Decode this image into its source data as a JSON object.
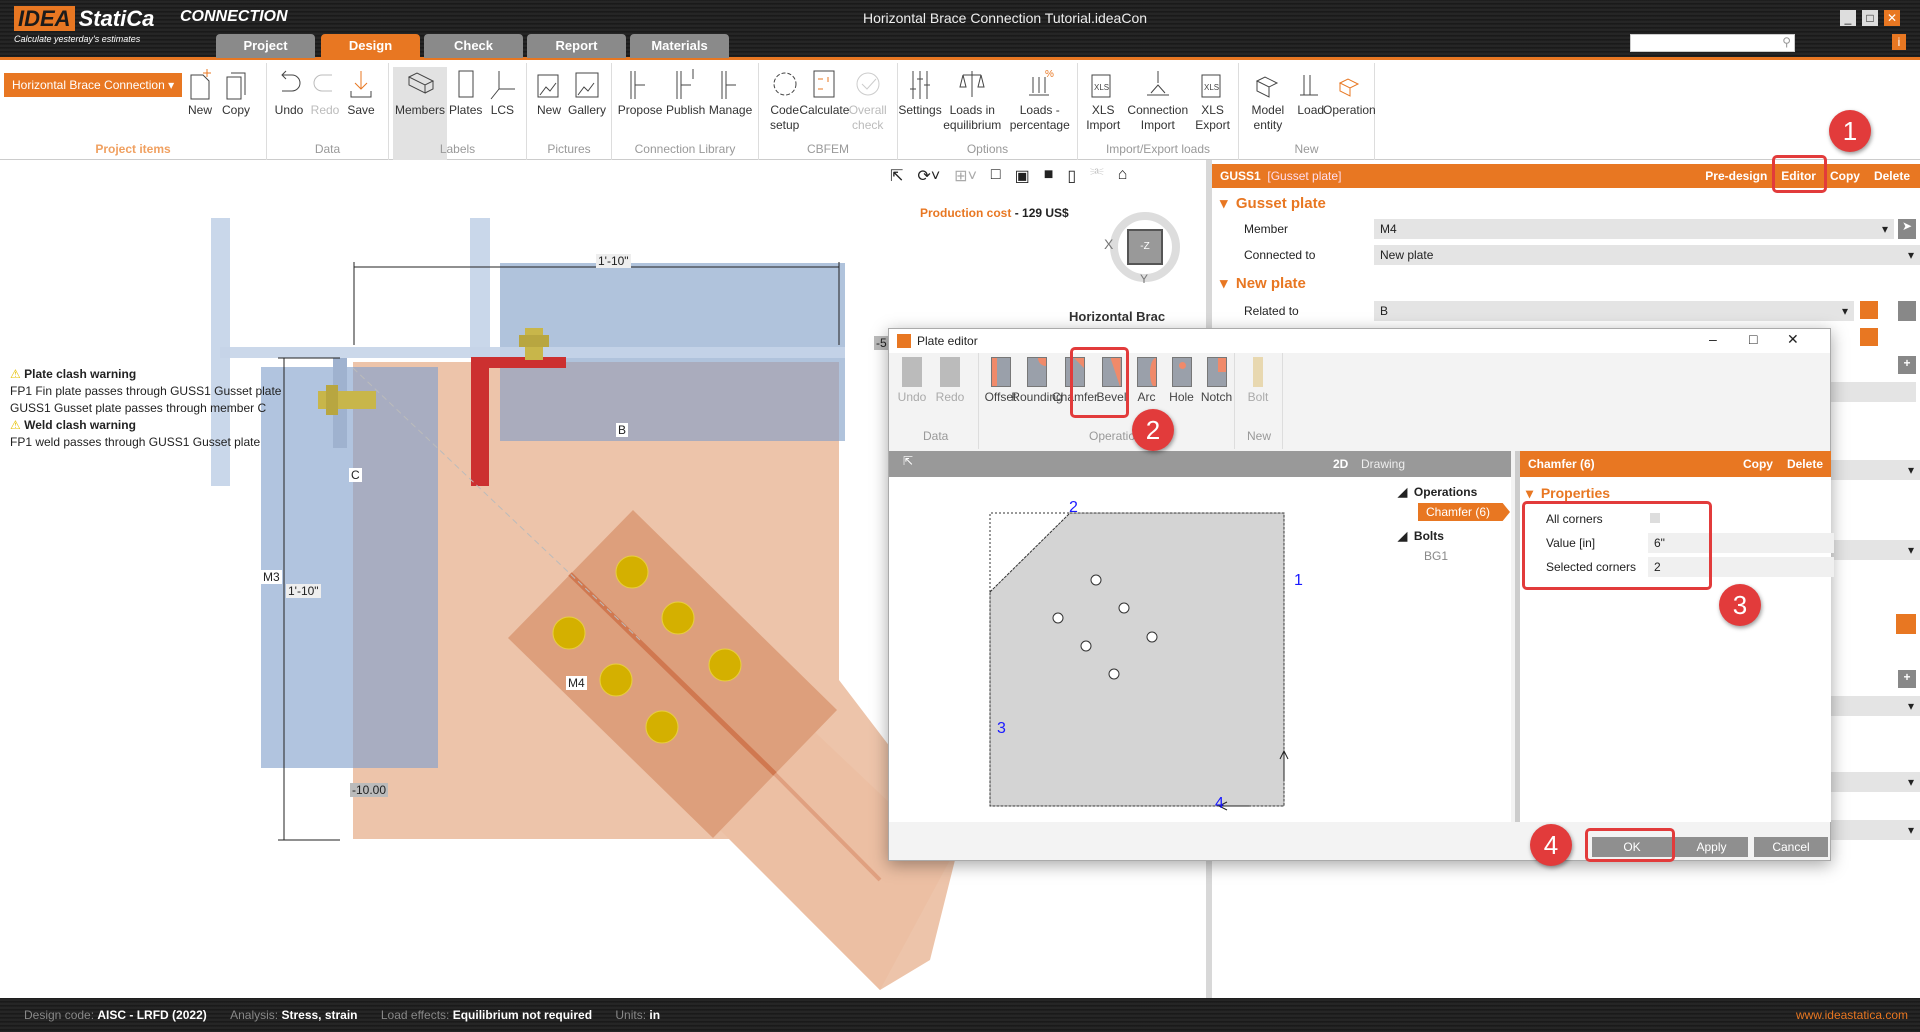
{
  "app": {
    "logo": "IDEA StatiCa",
    "product": "CONNECTION",
    "tagline": "Calculate yesterday's estimates",
    "window_title": "Horizontal Brace Connection Tutorial.ideaCon"
  },
  "tabs": [
    "Project",
    "Design",
    "Check",
    "Report",
    "Materials"
  ],
  "ribbon": {
    "project_items": {
      "dropdown": "Horizontal Brace Connection",
      "buttons": [
        "New",
        "Copy"
      ],
      "label": "Project items"
    },
    "data": {
      "buttons": [
        "Undo",
        "Redo",
        "Save"
      ],
      "label": "Data"
    },
    "labels": {
      "buttons": [
        "Members",
        "Plates",
        "LCS"
      ],
      "label": "Labels"
    },
    "pictures": {
      "buttons": [
        "New",
        "Gallery"
      ],
      "label": "Pictures"
    },
    "library": {
      "buttons": [
        "Propose",
        "Publish",
        "Manage"
      ],
      "label": "Connection Library"
    },
    "cbfem": {
      "buttons": [
        "Code setup",
        "Calculate",
        "Overall check"
      ],
      "label": "CBFEM"
    },
    "options": {
      "buttons": [
        "Settings",
        "Loads in equilibrium",
        "Loads - percentage"
      ],
      "label": "Options"
    },
    "io": {
      "buttons": [
        "XLS Import",
        "Connection Import",
        "XLS Export"
      ],
      "label": "Import/Export loads"
    },
    "new": {
      "buttons": [
        "Model entity",
        "Load",
        "Operation"
      ],
      "label": "New"
    }
  },
  "warnings": [
    {
      "title": "Plate clash warning",
      "lines": [
        "FP1 Fin plate passes through GUSS1 Gusset plate",
        "GUSS1 Gusset plate passes through member C"
      ]
    },
    {
      "title": "Weld clash warning",
      "lines": [
        "FP1 weld passes through GUSS1 Gusset plate"
      ]
    }
  ],
  "canvas": {
    "cost_label": "Production cost",
    "cost_sep": "-",
    "cost_value": "129 US$",
    "view_title": "Horizontal Brac",
    "cube": {
      "face": "-Z",
      "x": "X",
      "y": "Y"
    },
    "labels": {
      "dim_top": "1'-10\"",
      "dim_left": "1'-10\"",
      "m3": "M3",
      "c": "C",
      "b": "B",
      "m4": "M4",
      "elev": "-10.00",
      "edge": "-5"
    }
  },
  "panel": {
    "item": "GUSS1",
    "type": "[Gusset plate]",
    "actions": [
      "Pre-design",
      "Editor",
      "Copy",
      "Delete"
    ],
    "gusset_section": "Gusset plate",
    "member_label": "Member",
    "member_value": "M4",
    "connected_label": "Connected to",
    "connected_value": "New plate",
    "newplate_section": "New plate",
    "related_label": "Related to",
    "related_value": "B"
  },
  "dialog": {
    "title": "Plate editor",
    "tools_data": [
      "Undo",
      "Redo"
    ],
    "tools_ops": [
      "Offset",
      "Rounding",
      "Chamfer",
      "Bevel",
      "Arc",
      "Hole",
      "Notch"
    ],
    "tools_new": [
      "Bolt"
    ],
    "groups": [
      "Data",
      "Operations",
      "New"
    ],
    "view_mode": "2D",
    "view_label": "Drawing",
    "corners": [
      "1",
      "2",
      "3",
      "4"
    ],
    "tree": {
      "operations": "Operations",
      "chamfer": "Chamfer  (6)",
      "bolts": "Bolts",
      "bg1": "BG1"
    },
    "props": {
      "header": "Chamfer  (6)",
      "copy": "Copy",
      "delete": "Delete",
      "section": "Properties",
      "all_corners_label": "All corners",
      "all_corners_checked": false,
      "value_label": "Value [in]",
      "value": "6\"",
      "selected_label": "Selected corners",
      "selected": "2"
    },
    "buttons": {
      "ok": "OK",
      "apply": "Apply",
      "cancel": "Cancel"
    }
  },
  "callouts": [
    "1",
    "2",
    "3",
    "4"
  ],
  "status": {
    "code_label": "Design code:",
    "code": "AISC - LRFD (2022)",
    "analysis_label": "Analysis:",
    "analysis": "Stress, strain",
    "load_label": "Load effects:",
    "load": "Equilibrium not required",
    "units_label": "Units:",
    "units": "in",
    "site": "www.ideastatica.com"
  },
  "colors": {
    "accent": "#e87722",
    "callout": "#e23b3b"
  }
}
